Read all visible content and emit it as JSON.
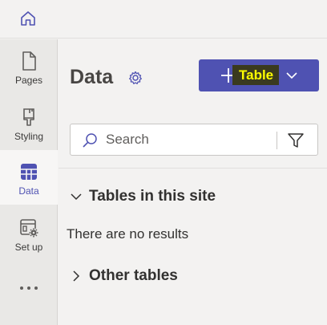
{
  "topbar": {
    "home_icon": "home-icon"
  },
  "rail": {
    "items": [
      {
        "label": "Pages",
        "icon": "page-icon",
        "active": false
      },
      {
        "label": "Styling",
        "icon": "paintbrush-icon",
        "active": false
      },
      {
        "label": "Data",
        "icon": "table-icon",
        "active": true
      },
      {
        "label": "Set up",
        "icon": "settings-window-icon",
        "active": false
      }
    ],
    "more_icon": "more-horizontal-icon"
  },
  "main": {
    "title": "Data",
    "add_table_button_label": "Table",
    "search": {
      "placeholder": "Search"
    },
    "sections": [
      {
        "label": "Tables in this site",
        "expanded": true,
        "empty_text": "There are no results"
      },
      {
        "label": "Other tables",
        "expanded": false
      }
    ]
  },
  "colors": {
    "accent": "#4f52b2",
    "highlight_text": "#ffff00"
  }
}
